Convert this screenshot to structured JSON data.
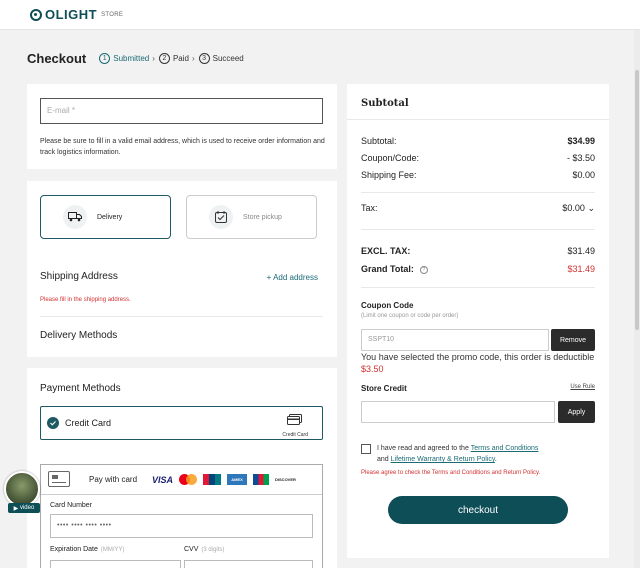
{
  "brand": {
    "logo": "OLIGHT",
    "logo_sub": "STORE"
  },
  "checkout": {
    "title": "Checkout",
    "steps": [
      {
        "num": "1",
        "label": "Submitted",
        "active": true
      },
      {
        "num": "2",
        "label": "Paid"
      },
      {
        "num": "3",
        "label": "Succeed"
      }
    ]
  },
  "email": {
    "placeholder": "E-mail *",
    "help": "Please be sure to fill in a valid email address, which is used to receive order information and track logistics information."
  },
  "shipping": {
    "delivery_label": "Delivery",
    "pickup_label": "Store pickup",
    "address_title": "Shipping Address",
    "add_address": "+ Add address",
    "address_error": "Please fill in the shipping address.",
    "methods_title": "Delivery Methods"
  },
  "payment": {
    "title": "Payment Methods",
    "credit_card_label": "Credit Card",
    "credit_card_logo_text": "Credit Card",
    "pay_with_card": "Pay with card",
    "brands": {
      "visa": "VISA",
      "amex": "AMEX",
      "discover": "DISCOVER"
    },
    "card_number_label": "Card Number",
    "card_number_value": "•••• •••• •••• ••••",
    "expiration_label": "Expiration Date",
    "expiration_hint": "(MM/YY)",
    "cvv_label": "CVV",
    "cvv_hint": "(3 digits)"
  },
  "summary": {
    "title": "Subtotal",
    "subtotal_label": "Subtotal:",
    "subtotal_value": "$34.99",
    "coupon_label": "Coupon/Code:",
    "coupon_value": "- $3.50",
    "shipping_label": "Shipping Fee:",
    "shipping_value": "$0.00",
    "tax_label": "Tax:",
    "tax_value": "$0.00",
    "excl_tax_label": "EXCL. TAX:",
    "excl_tax_value": "$31.49",
    "grand_total_label": "Grand Total:",
    "grand_total_value": "$31.49",
    "coupon_code_title": "Coupon Code",
    "coupon_code_hint": "(Limit one coupon or code per order)",
    "coupon_code_value": "SSPT10",
    "remove_label": "Remove",
    "promo_message": "You have selected the promo code, this order is deductible",
    "promo_amount": "$3.50",
    "store_credit_label": "Store Credit",
    "use_rule": "Use Rule",
    "apply_label": "Apply",
    "agree_prefix": "I have read and agreed to the",
    "terms_link": "Terms and Conditions",
    "agree_and": "and",
    "warranty_link": "Lifetime Warranty & Return Policy",
    "agree_error": "Please agree to check the Terms and Conditions and Return Policy.",
    "checkout_label": "checkout"
  },
  "video": {
    "label": "video"
  },
  "colors": {
    "accent": "#0e4e57",
    "error": "#d23232",
    "step_active": "#1a6b76"
  }
}
